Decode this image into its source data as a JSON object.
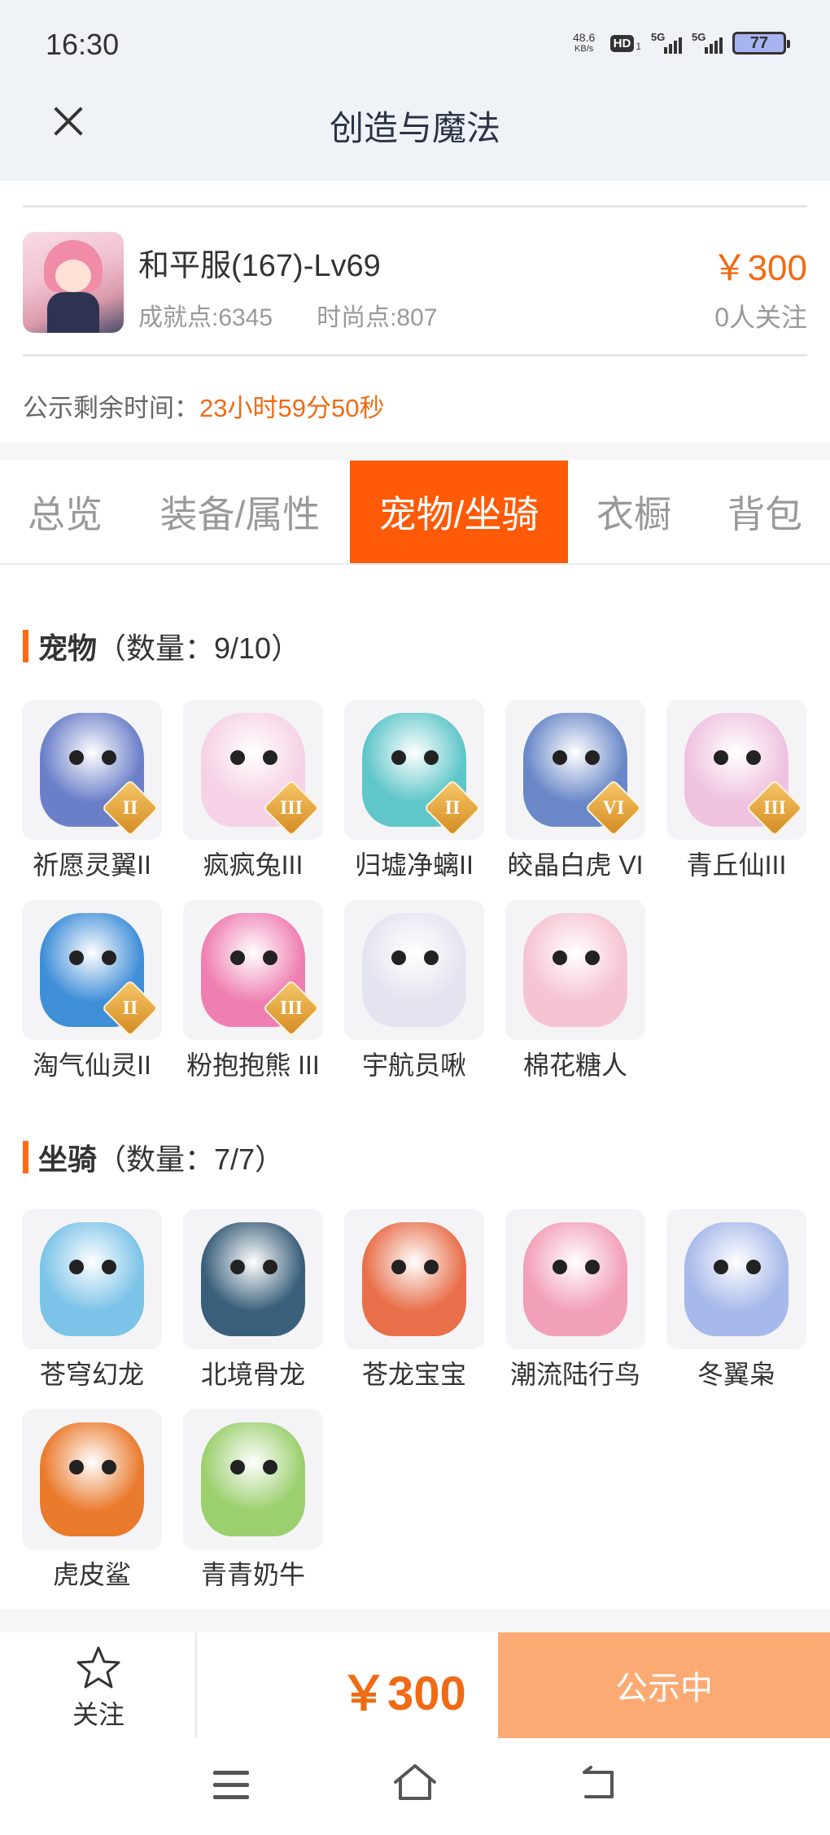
{
  "status_bar": {
    "time": "16:30",
    "net_speed_value": "48.6",
    "net_speed_unit": "KB/s",
    "hd_label": "HD",
    "hd_sub": "1",
    "signal1": "5G",
    "signal2": "5G",
    "battery": "77"
  },
  "header": {
    "title": "创造与魔法",
    "close_icon": "close-icon"
  },
  "role": {
    "name": "和平服(167)-Lv69",
    "achievement": "成就点:6345",
    "fashion": "时尚点:807",
    "price": "￥300",
    "followers": "0人关注",
    "timer_label": "公示剩余时间：",
    "timer_value": "23小时59分50秒"
  },
  "tabs": [
    {
      "label": "总览",
      "active": false
    },
    {
      "label": "装备/属性",
      "active": false
    },
    {
      "label": "宠物/坐骑",
      "active": true
    },
    {
      "label": "衣橱",
      "active": false
    },
    {
      "label": "背包",
      "active": false
    }
  ],
  "pets": {
    "title": "宠物",
    "count": "（数量：9/10）",
    "items": [
      {
        "name": "祈愿灵翼II",
        "rank": "II",
        "color": "#6b7fc9"
      },
      {
        "name": "疯疯兔III",
        "rank": "III",
        "color": "#f6d2e6"
      },
      {
        "name": "归墟净螭II",
        "rank": "II",
        "color": "#5fc6c9"
      },
      {
        "name": "皎晶白虎 VI",
        "rank": "VI",
        "color": "#6a88c8"
      },
      {
        "name": "青丘仙III",
        "rank": "III",
        "color": "#efc3e0"
      },
      {
        "name": "淘气仙灵II",
        "rank": "II",
        "color": "#3f8ed8"
      },
      {
        "name": "粉抱抱熊 III",
        "rank": "III",
        "color": "#ef7fb2"
      },
      {
        "name": "宇航员啾",
        "rank": "",
        "color": "#e4e4f0"
      },
      {
        "name": "棉花糖人",
        "rank": "",
        "color": "#f6c3d2"
      }
    ]
  },
  "mounts": {
    "title": "坐骑",
    "count": "（数量：7/7）",
    "items": [
      {
        "name": "苍穹幻龙",
        "color": "#7cc3e8"
      },
      {
        "name": "北境骨龙",
        "color": "#3a5f7a"
      },
      {
        "name": "苍龙宝宝",
        "color": "#e86f4a"
      },
      {
        "name": "潮流陆行鸟",
        "color": "#f2a0b8"
      },
      {
        "name": "冬翼枭",
        "color": "#a7b9ea"
      },
      {
        "name": "虎皮鲨",
        "color": "#ea7a2c"
      },
      {
        "name": "青青奶牛",
        "color": "#9ccf6e"
      }
    ]
  },
  "action_bar": {
    "follow_label": "关注",
    "price": "￥300",
    "status": "公示中"
  },
  "colors": {
    "accent": "#fe5a08",
    "price": "#f06a14",
    "status_button": "#fcaa74"
  }
}
